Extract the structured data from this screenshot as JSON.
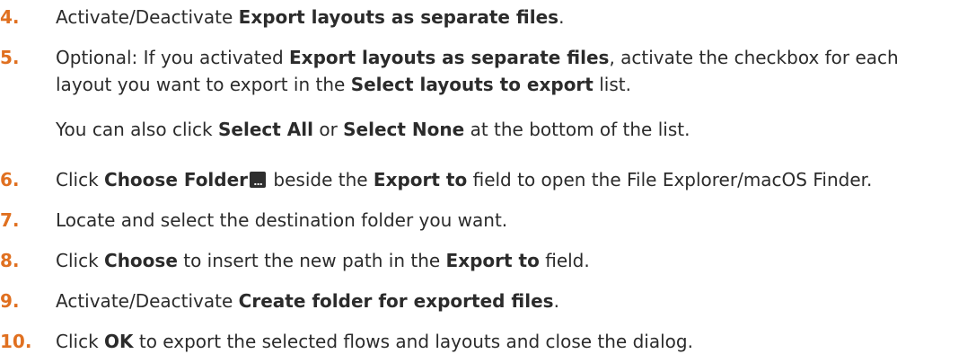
{
  "steps": [
    {
      "number": "4.",
      "lines": [
        [
          {
            "t": "Activate/Deactivate "
          },
          {
            "t": "Export layouts as separate files",
            "b": true
          },
          {
            "t": "."
          }
        ]
      ]
    },
    {
      "number": "5.",
      "lines": [
        [
          {
            "t": "Optional: If you activated "
          },
          {
            "t": "Export layouts as separate files",
            "b": true
          },
          {
            "t": ", activate the checkbox for each"
          }
        ],
        [
          {
            "t": "layout you want to export in the "
          },
          {
            "t": "Select layouts to export",
            "b": true
          },
          {
            "t": " list."
          }
        ],
        [
          {
            "t": "You can also click "
          },
          {
            "t": "Select All",
            "b": true
          },
          {
            "t": " or "
          },
          {
            "t": "Select None",
            "b": true
          },
          {
            "t": " at the bottom of the list."
          }
        ]
      ]
    },
    {
      "number": "6.",
      "lines": [
        [
          {
            "t": "Click "
          },
          {
            "t": "Choose Folder",
            "b": true
          },
          {
            "icon": "choose-folder-ellipsis-icon",
            "glyph": "..."
          },
          {
            "t": " beside the "
          },
          {
            "t": "Export to",
            "b": true
          },
          {
            "t": " field to open the File Explorer/macOS Finder."
          }
        ]
      ]
    },
    {
      "number": "7.",
      "lines": [
        [
          {
            "t": "Locate and select the destination folder you want."
          }
        ]
      ]
    },
    {
      "number": "8.",
      "lines": [
        [
          {
            "t": "Click "
          },
          {
            "t": "Choose",
            "b": true
          },
          {
            "t": " to insert the new path in the "
          },
          {
            "t": "Export to",
            "b": true
          },
          {
            "t": " field."
          }
        ]
      ]
    },
    {
      "number": "9.",
      "lines": [
        [
          {
            "t": "Activate/Deactivate "
          },
          {
            "t": "Create folder for exported files",
            "b": true
          },
          {
            "t": "."
          }
        ]
      ]
    },
    {
      "number": "10.",
      "lines": [
        [
          {
            "t": "Click "
          },
          {
            "t": "OK",
            "b": true
          },
          {
            "t": " to export the selected flows and layouts and close the dialog."
          }
        ]
      ]
    }
  ],
  "colors": {
    "number": "#e07020",
    "text": "#2b2b2b",
    "icon_bg": "#2e2e2e"
  }
}
